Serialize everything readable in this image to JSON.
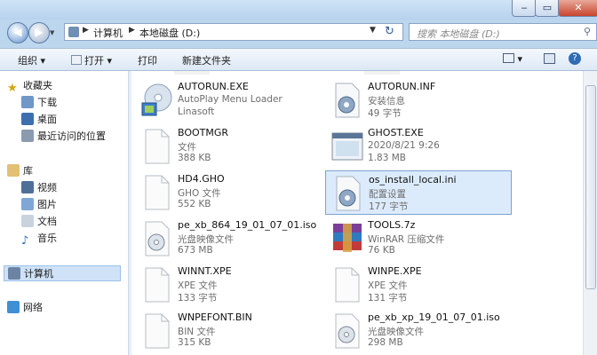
{
  "window": {
    "minimize_label": "‒",
    "maximize_label": "▭",
    "close_label": "✕"
  },
  "address": {
    "back_glyph": "◀",
    "forward_glyph": "▶",
    "crumbs": [
      "计算机",
      "本地磁盘 (D:)"
    ],
    "refresh_glyph": "↻",
    "search_placeholder": "搜索 本地磁盘 (D:)"
  },
  "toolbar": {
    "organize": "组织",
    "open": "打开",
    "print": "打印",
    "new_folder": "新建文件夹"
  },
  "sidebar": {
    "favorites": "收藏夹",
    "downloads": "下载",
    "desktop": "桌面",
    "recent": "最近访问的位置",
    "libraries": "库",
    "videos": "视频",
    "pictures": "图片",
    "documents": "文档",
    "music": "音乐",
    "computer": "计算机",
    "network": "网络"
  },
  "files": [
    {
      "name": "AUTORUN.EXE",
      "type": "AutoPlay Menu Loader",
      "size": "Linasoft",
      "icon": "cd-setup-icon"
    },
    {
      "name": "AUTORUN.INF",
      "type": "安装信息",
      "size": "49 字节",
      "icon": "gear-file-icon"
    },
    {
      "name": "BOOTMGR",
      "type": "文件",
      "size": "388 KB",
      "icon": "blank-file-icon"
    },
    {
      "name": "GHOST.EXE",
      "type": "2020/8/21 9:26",
      "size": "1.83 MB",
      "icon": "window-app-icon"
    },
    {
      "name": "HD4.GHO",
      "type": "GHO 文件",
      "size": "552 KB",
      "icon": "blank-file-icon"
    },
    {
      "name": "os_install_local.ini",
      "type": "配置设置",
      "size": "177 字节",
      "icon": "gear-file-icon"
    },
    {
      "name": "pe_xb_864_19_01_07_01.iso",
      "type": "光盘映像文件",
      "size": "673 MB",
      "icon": "disc-file-icon"
    },
    {
      "name": "TOOLS.7z",
      "type": "WinRAR 压缩文件",
      "size": "76 KB",
      "icon": "winrar-icon"
    },
    {
      "name": "WINNT.XPE",
      "type": "XPE 文件",
      "size": "133 字节",
      "icon": "blank-file-icon"
    },
    {
      "name": "WINPE.XPE",
      "type": "XPE 文件",
      "size": "131 字节",
      "icon": "blank-file-icon"
    },
    {
      "name": "WNPEFONT.BIN",
      "type": "BIN 文件",
      "size": "315 KB",
      "icon": "blank-file-icon"
    },
    {
      "name": "pe_xb_xp_19_01_07_01.iso",
      "type": "光盘映像文件",
      "size": "298 MB",
      "icon": "disc-file-icon"
    }
  ],
  "selected_file": "os_install_local.ini"
}
